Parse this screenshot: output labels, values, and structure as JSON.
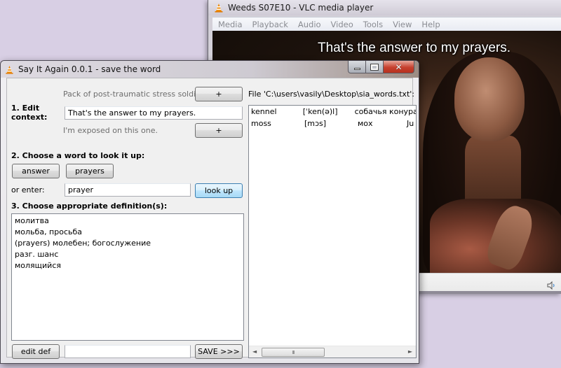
{
  "vlc": {
    "title": "Weeds S07E10 - VLC media player",
    "menu": [
      "Media",
      "Playback",
      "Audio",
      "Video",
      "Tools",
      "View",
      "Help"
    ],
    "subtitle": "That's the answer to my prayers.",
    "icons": {
      "app": "vlc-cone-icon",
      "volume": "speaker-icon"
    }
  },
  "sia": {
    "title": "Say It Again 0.0.1 - save the word",
    "window_controls": {
      "minimize": "minimize-icon",
      "maximize": "maximize-icon",
      "close": "close-icon"
    },
    "section1": {
      "label": "1. Edit context:",
      "prev_context": "Pack of post-traumatic stress soldiers --",
      "prev_add_label": "+",
      "context_value": "That's the answer to my prayers.",
      "next_context": "I'm exposed on this one.",
      "next_add_label": "+"
    },
    "section2": {
      "label": "2. Choose a word to look it up:",
      "word_buttons": [
        "answer",
        "prayers"
      ],
      "or_enter_label": "or enter:",
      "lookup_value": "prayer",
      "lookup_button": "look up"
    },
    "section3": {
      "label": "3. Choose appropriate definition(s):",
      "definitions": [
        "молитва",
        "мольба, просьба",
        "(prayers) молебен; богослужение",
        "разг. шанс",
        "молящийся"
      ]
    },
    "bottom": {
      "edit_def_label": "edit def",
      "def_value": "",
      "save_label": "SAVE >>>"
    },
    "file": {
      "label": "File 'C:\\users\\vasily\\Desktop\\sia_words.txt':",
      "rows": [
        [
          "kennel",
          "[ˈken(ə)l]",
          "собачья конура"
        ],
        [
          "moss",
          "[mɔs]",
          "мох",
          "Ju"
        ]
      ],
      "scroll_left": "◄",
      "scroll_right": "►",
      "scroll_grip": "III"
    }
  }
}
